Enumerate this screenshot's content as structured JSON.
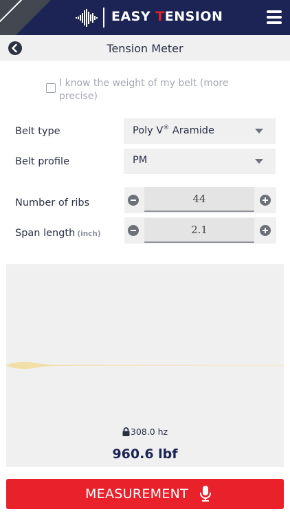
{
  "colors": {
    "header_bg": "#1b2454",
    "accent": "#e32124",
    "button_bg": "#e8212b",
    "panel_bg": "#f0f0f0",
    "wave": "#f2dfa8"
  },
  "header": {
    "logo_part1": "EASY ",
    "logo_accent": "T",
    "logo_part2": "ENSION",
    "menu_icon": "hamburger-icon",
    "logo_icon": "soundwave-icon"
  },
  "subheader": {
    "title": "Tension Meter",
    "back_icon": "back-arrow-icon"
  },
  "weight_option": {
    "checked": false,
    "label": "I know the weight of my belt (more precise)"
  },
  "belt_type": {
    "label": "Belt type",
    "value_main": "Poly V",
    "value_sup": "®",
    "value_rest": " Aramide"
  },
  "belt_profile": {
    "label": "Belt profile",
    "value": "PM"
  },
  "ribs": {
    "label": "Number of ribs",
    "value": "44"
  },
  "span": {
    "label": "Span length",
    "unit": "(inch)",
    "value": "2.1"
  },
  "result": {
    "frequency": "308.0 hz",
    "force": "960.6 lbf",
    "lock_icon": "lock-icon"
  },
  "measure_button": {
    "label": "MEASUREMENT",
    "icon": "microphone-icon"
  }
}
